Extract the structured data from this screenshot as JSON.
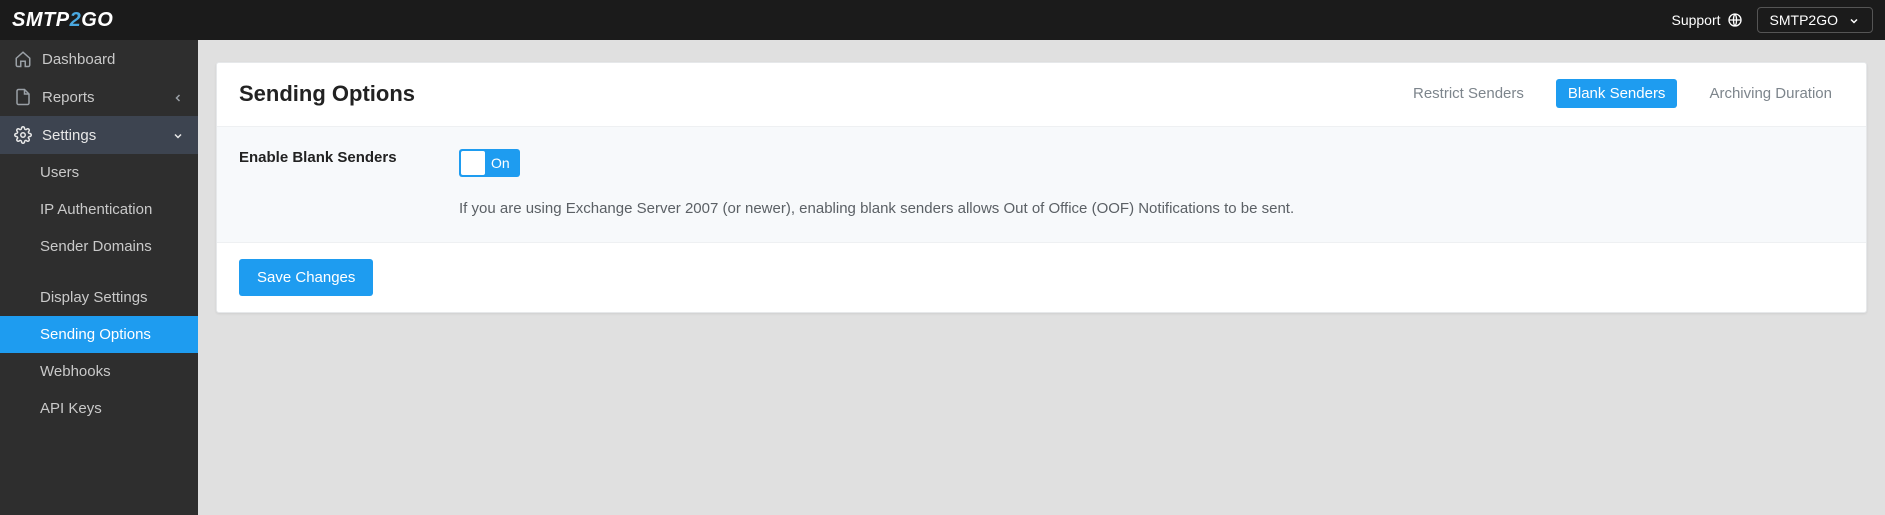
{
  "header": {
    "logo_pre": "SMTP",
    "logo_accent": "2",
    "logo_post": "GO",
    "support_label": "Support",
    "account_name": "SMTP2GO"
  },
  "sidebar": {
    "dashboard": "Dashboard",
    "reports": "Reports",
    "settings": "Settings",
    "settings_children": {
      "users": "Users",
      "ip_auth": "IP Authentication",
      "sender_domains": "Sender Domains",
      "display_settings": "Display Settings",
      "sending_options": "Sending Options",
      "webhooks": "Webhooks",
      "api_keys": "API Keys"
    }
  },
  "page": {
    "title": "Sending Options",
    "tabs": {
      "restrict_senders": "Restrict Senders",
      "blank_senders": "Blank Senders",
      "archiving_duration": "Archiving Duration"
    },
    "setting_label": "Enable Blank Senders",
    "toggle_state": "On",
    "help_text": "If you are using Exchange Server 2007 (or newer), enabling blank senders allows Out of Office (OOF) Notifications to be sent.",
    "save_label": "Save Changes"
  },
  "colors": {
    "accent": "#1e9cf0"
  }
}
